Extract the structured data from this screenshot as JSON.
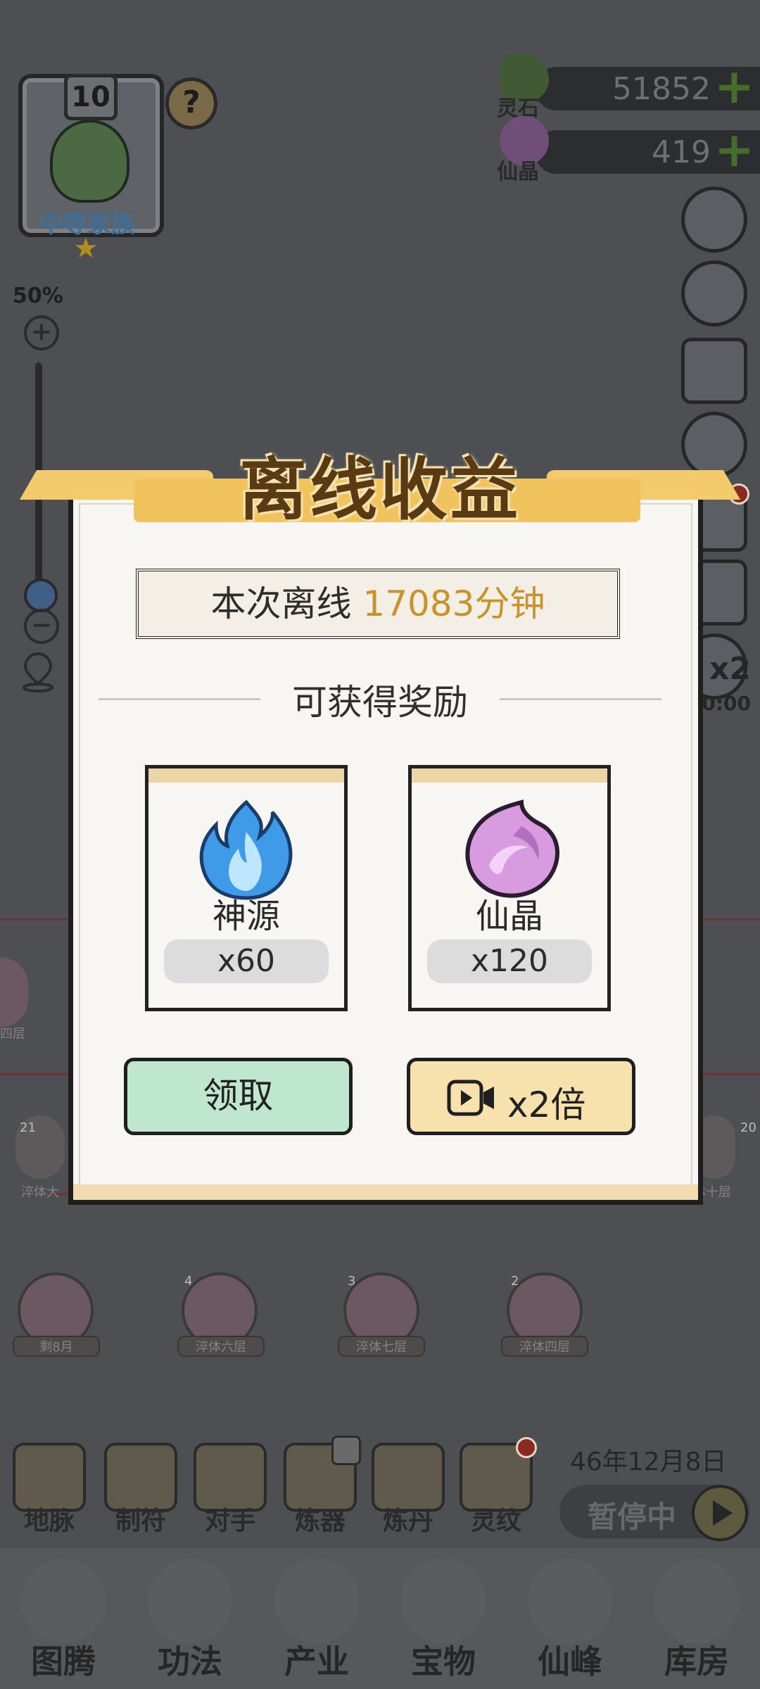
{
  "family": {
    "level": "10",
    "rank": "中等家族"
  },
  "zoom": {
    "label": "50%",
    "value_percent": 50
  },
  "currencies": [
    {
      "name": "灵石",
      "amount": "51852",
      "plus": "+"
    },
    {
      "name": "仙晶",
      "amount": "419",
      "plus": "+"
    }
  ],
  "help": "?",
  "lineage": {
    "members": [
      {
        "tag": "剩8月",
        "badge": ""
      },
      {
        "tag": "淬体六层",
        "badge": "4"
      },
      {
        "tag": "淬体七层",
        "badge": "3"
      },
      {
        "tag": "淬体四层",
        "badge": "2"
      }
    ],
    "side_left_1": "四层",
    "side_left_2": "淬体大",
    "side_left_badge": "21",
    "side_right_tag": "体十层",
    "side_right_badge": "20"
  },
  "actions": [
    "地脉",
    "制符",
    "对手",
    "炼器",
    "炼丹",
    "灵纹"
  ],
  "game_date": "46年12月8日",
  "pause_label": "暂停中",
  "bottom_nav": [
    "图腾",
    "功法",
    "产业",
    "宝物",
    "仙峰",
    "库房"
  ],
  "side_partial": {
    "x2": "x2",
    "timer": "0:00"
  },
  "modal": {
    "title": "离线收益",
    "offline_label": "本次离线",
    "offline_value": "17083分钟",
    "rewards_header": "可获得奖励",
    "rewards": [
      {
        "name": "神源",
        "qty": "x60",
        "icon": "blue-flame-icon"
      },
      {
        "name": "仙晶",
        "qty": "x120",
        "icon": "purple-crystal-icon"
      }
    ],
    "claim_label": "领取",
    "double_label": "x2倍"
  },
  "colors": {
    "modal_title": "#5a3a12",
    "offline_value": "#c9932c",
    "claim_button": "#bfe6cf",
    "double_button": "#f7e2ad"
  }
}
